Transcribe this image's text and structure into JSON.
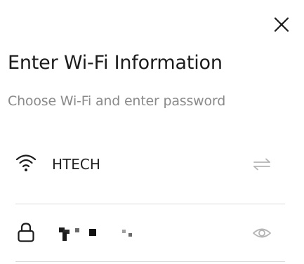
{
  "dialog": {
    "title": "Enter Wi-Fi Information",
    "subtitle": "Choose Wi-Fi and enter password",
    "close_icon": "close-icon"
  },
  "network": {
    "icon": "wifi-icon",
    "name": "HTECH",
    "change_icon": "swap-icon"
  },
  "password": {
    "icon": "lock-icon",
    "visibility_icon": "eye-icon"
  },
  "colors": {
    "text_primary": "#1c1c1c",
    "text_secondary": "#8a8a8a",
    "icon_muted": "#b5b5b5",
    "divider": "#dcdcdc"
  }
}
